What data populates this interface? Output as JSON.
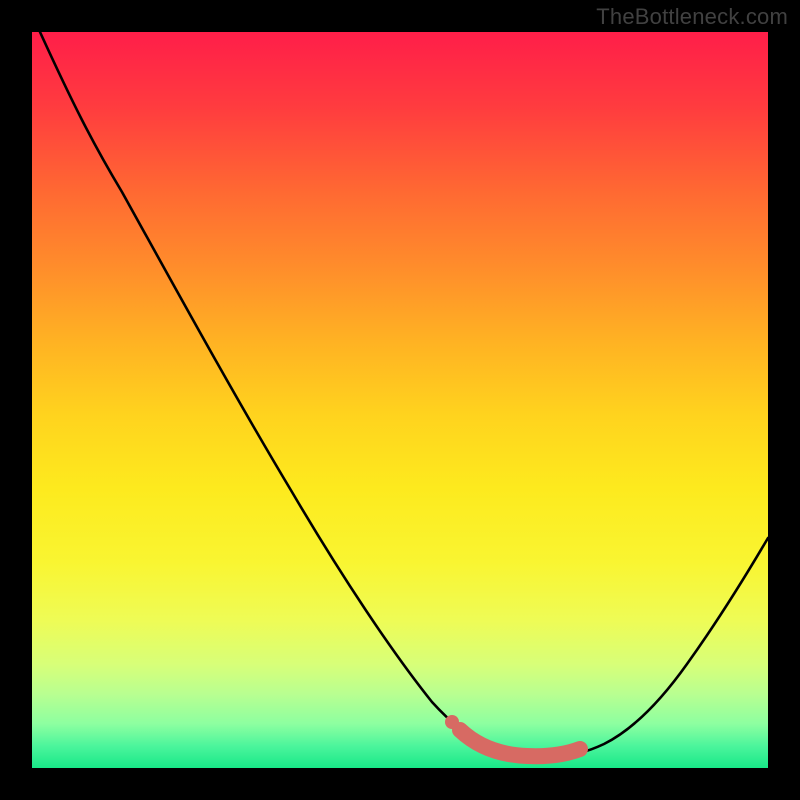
{
  "watermark": "TheBottleneck.com",
  "colors": {
    "gradient_top": "#ff1e49",
    "gradient_bottom": "#18e888",
    "curve": "#000000",
    "marker": "#d76a63",
    "frame": "#000000"
  },
  "chart_data": {
    "type": "line",
    "title": "",
    "xlabel": "",
    "ylabel": "",
    "xlim": [
      0,
      100
    ],
    "ylim": [
      0,
      100
    ],
    "x": [
      0,
      5,
      10,
      15,
      20,
      25,
      30,
      35,
      40,
      45,
      50,
      55,
      57,
      60,
      63,
      66,
      70,
      73,
      78,
      82,
      86,
      90,
      94,
      100
    ],
    "values": [
      100,
      92,
      84,
      76,
      68,
      60,
      52,
      44,
      36,
      28,
      20,
      12,
      9,
      6,
      4,
      2,
      1,
      0.7,
      0.7,
      1.5,
      4,
      8,
      15,
      30
    ],
    "marker_range_x": [
      57,
      74
    ],
    "marker_y": 7,
    "note": "Values are relative percentages read from a normalized 0-100 axis; the curve shows a steep V with minimum near x≈73 and a highlighted flat bottom segment."
  }
}
